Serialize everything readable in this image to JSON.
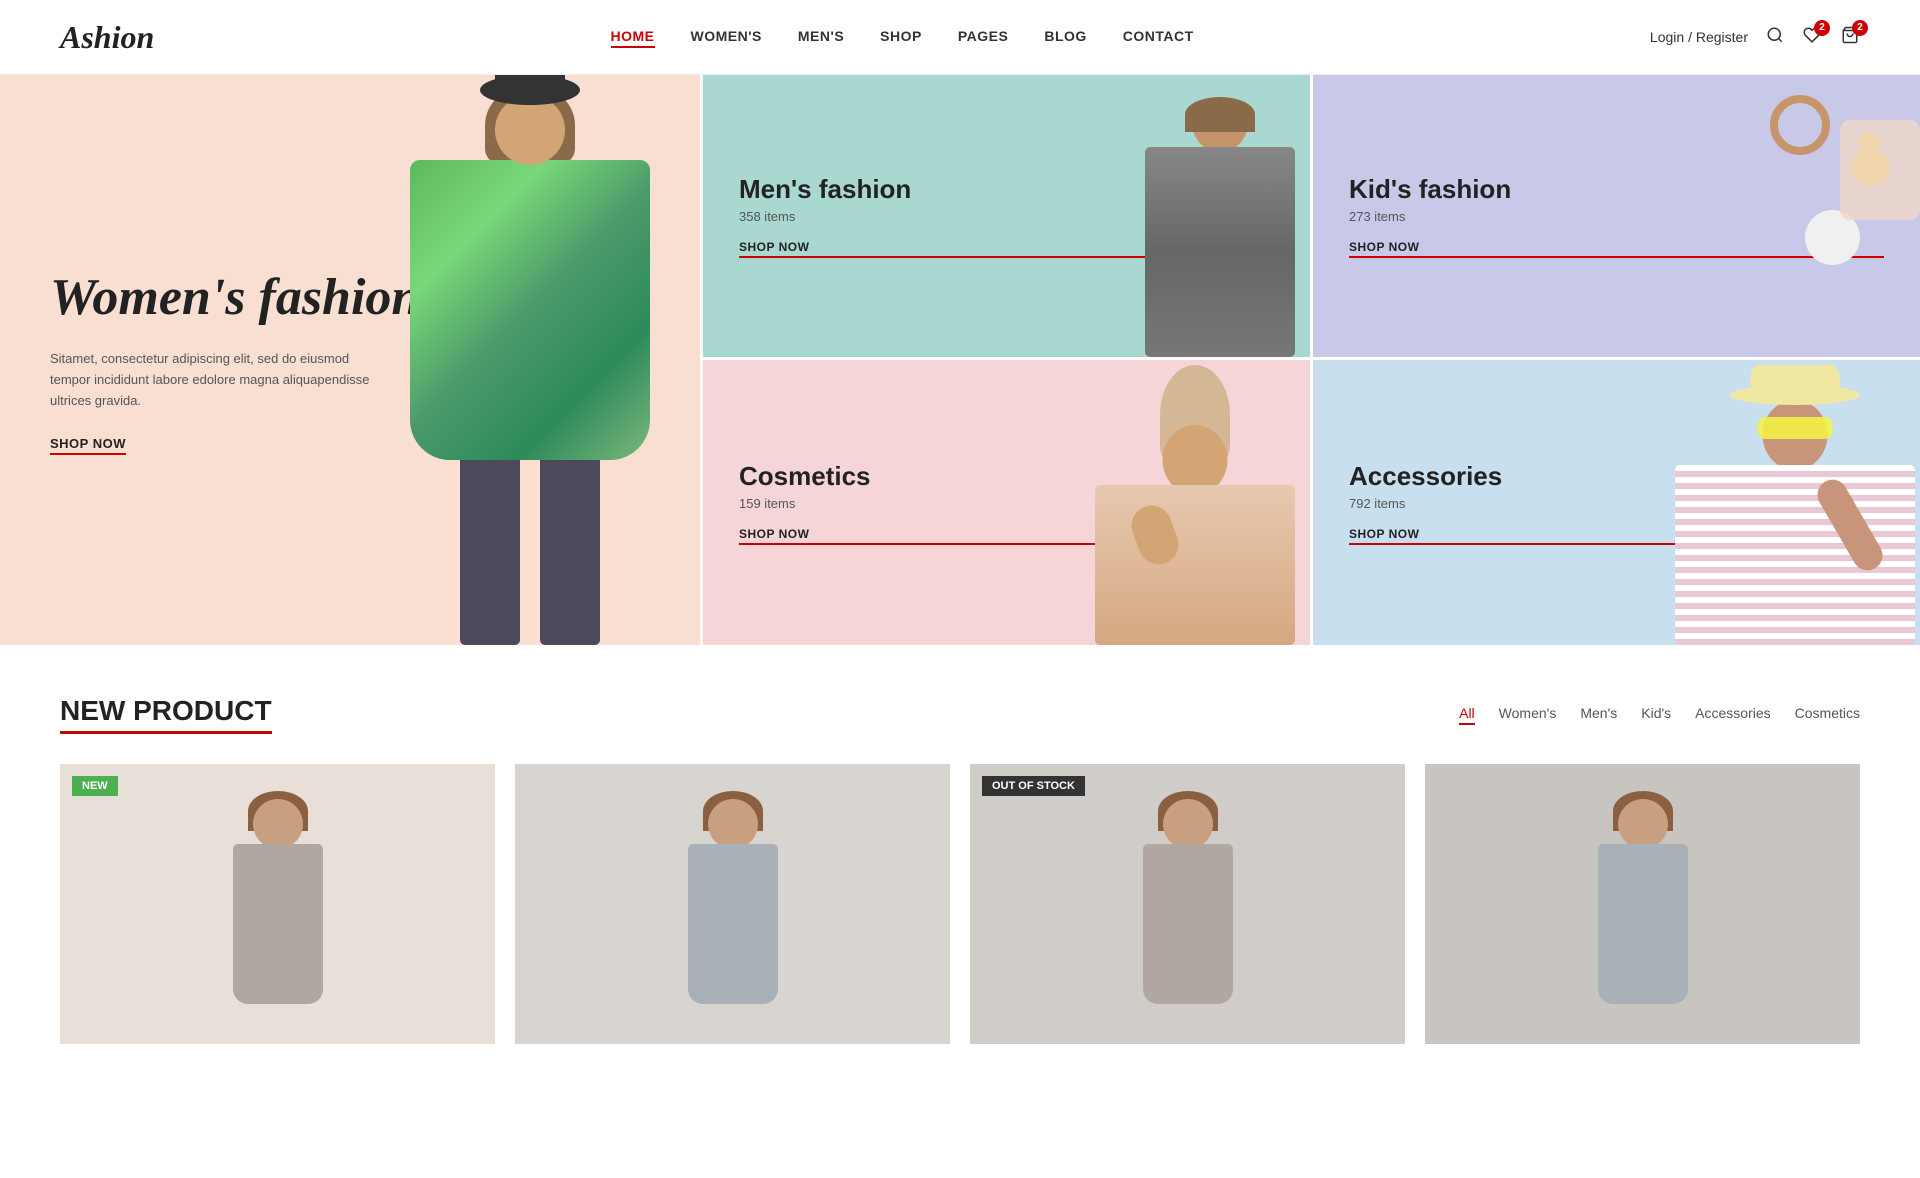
{
  "header": {
    "logo": "Ashion",
    "nav": [
      {
        "label": "HOME",
        "active": true
      },
      {
        "label": "WOMEN'S",
        "active": false
      },
      {
        "label": "MEN'S",
        "active": false
      },
      {
        "label": "SHOP",
        "active": false
      },
      {
        "label": "PAGES",
        "active": false
      },
      {
        "label": "BLOG",
        "active": false
      },
      {
        "label": "CONTACT",
        "active": false
      }
    ],
    "login_label": "Login / Register",
    "wishlist_count": "2",
    "cart_count": "2"
  },
  "hero": {
    "title": "Women's fashion",
    "description": "Sitamet, consectetur adipiscing elit, sed do eiusmod tempor incididunt labore edolore magna aliquapendisse ultrices gravida.",
    "shop_now": "SHOP NOW"
  },
  "categories": [
    {
      "id": "mens",
      "title": "Men's fashion",
      "items": "358 items",
      "shop_now": "SHOP NOW",
      "bg": "#a8d8d0"
    },
    {
      "id": "kids",
      "title": "Kid's fashion",
      "items": "273 items",
      "shop_now": "SHOP NOW",
      "bg": "#c8c8e8"
    },
    {
      "id": "cosmetics",
      "title": "Cosmetics",
      "items": "159 items",
      "shop_now": "SHOP NOW",
      "bg": "#f5d5d8"
    },
    {
      "id": "accessories",
      "title": "Accessories",
      "items": "792 items",
      "shop_now": "SHOP NOW",
      "bg": "#c8dff0"
    }
  ],
  "new_product": {
    "title": "NEW PRODUCT",
    "filters": [
      {
        "label": "All",
        "active": true
      },
      {
        "label": "Women's",
        "active": false
      },
      {
        "label": "Men's",
        "active": false
      },
      {
        "label": "Kid's",
        "active": false
      },
      {
        "label": "Accessories",
        "active": false
      },
      {
        "label": "Cosmetics",
        "active": false
      }
    ],
    "products": [
      {
        "badge": "NEW",
        "badge_type": "new",
        "bg": "#e8e0d8"
      },
      {
        "badge": "",
        "badge_type": "",
        "bg": "#d8d4d0"
      },
      {
        "badge": "OUT OF STOCK",
        "badge_type": "out",
        "bg": "#d0ccc8"
      },
      {
        "badge": "",
        "badge_type": "",
        "bg": "#c8c4c0"
      }
    ]
  }
}
